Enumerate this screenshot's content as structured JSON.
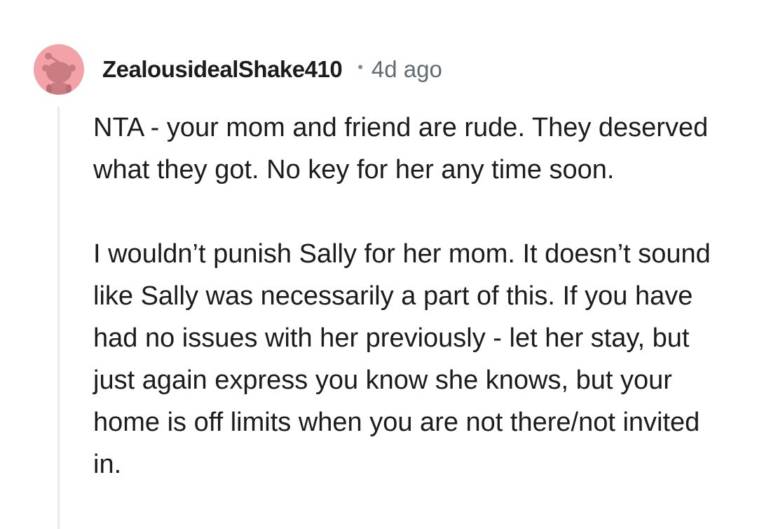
{
  "comment": {
    "username": "ZealousidealShake410",
    "separator": "•",
    "timestamp": "4d ago",
    "paragraphs": [
      "NTA - your mom and friend are rude. They deserved what they got. No key for her any time soon.",
      "I wouldn’t punish Sally for her mom. It doesn’t sound like Sally was necessarily a part of this. If you have had no issues with her previously - let her stay, but just again express you know she knows, but your home is off limits when you are not there/not invited in."
    ]
  },
  "colors": {
    "avatar_bg": "#f3a3a7",
    "avatar_figure": "#c97d82",
    "thread_line": "#e8e9ea",
    "meta_gray": "#5f6c74"
  },
  "icons": {
    "avatar": "snoo-avatar-icon"
  }
}
